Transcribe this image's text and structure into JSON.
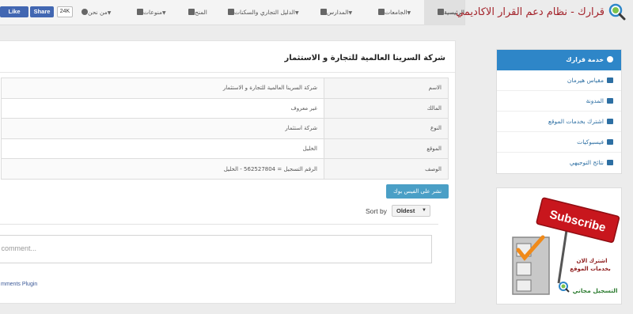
{
  "brand": {
    "title": "قرارك - نظام دعم القرار الاكاديمي",
    "logo": "search-magnifier-logo"
  },
  "nav": [
    {
      "label": "الرئيسية",
      "icon": "home-icon"
    },
    {
      "label": "الجامعات",
      "icon": "university-icon"
    },
    {
      "label": "المدارس",
      "icon": "book-icon"
    },
    {
      "label": "الدليل التجاري والسكنات",
      "icon": "building-icon"
    },
    {
      "label": "المنح",
      "icon": "gift-icon"
    },
    {
      "label": "منوعات",
      "icon": "random-icon"
    },
    {
      "label": "من نحن",
      "icon": "info-icon"
    }
  ],
  "social": {
    "like": "Like",
    "share": "Share",
    "count": "24K"
  },
  "main": {
    "heading": "شركة السرينا العالمية للتجارة و الاستثمار",
    "rows": [
      {
        "k": "الاسم",
        "v": "شركة السرينا العالمية للتجارة و الاستثمار"
      },
      {
        "k": "المالك",
        "v": "غير معروف"
      },
      {
        "k": "النوع",
        "v": "شركة استثمار"
      },
      {
        "k": "الموقع",
        "v": "الخليل"
      },
      {
        "k": "الوصف",
        "v": "الرقم التسجيل = 562527804 - الخليل"
      }
    ],
    "share_btn": "نشر على الفيس بوك",
    "sort_label": "Sort by",
    "sort_value": "Oldest",
    "comment_placeholder": "a comment...",
    "plugin": "mments Plugin"
  },
  "sidebar": {
    "header": "خدمة قرارك",
    "items": [
      {
        "label": "مقياس هيرمان",
        "icon": "grid-icon"
      },
      {
        "label": "المدونة",
        "icon": "newspaper-icon"
      },
      {
        "label": "اشترك بخدمات الموقع",
        "icon": "user-plus-icon"
      },
      {
        "label": "فيسبوكيات",
        "icon": "facebook-icon"
      },
      {
        "label": "نتائج التوجيهي",
        "icon": "graduation-cap-icon"
      }
    ]
  },
  "ad": {
    "subscribe": "Subscribe",
    "line1": "اشترك الان",
    "line2": "بخدمات الموقع",
    "free": "التسجيل مجاني"
  },
  "colors": {
    "accent": "#2e86c8",
    "brand_red": "#a3222a",
    "facebook": "#4267b2"
  }
}
